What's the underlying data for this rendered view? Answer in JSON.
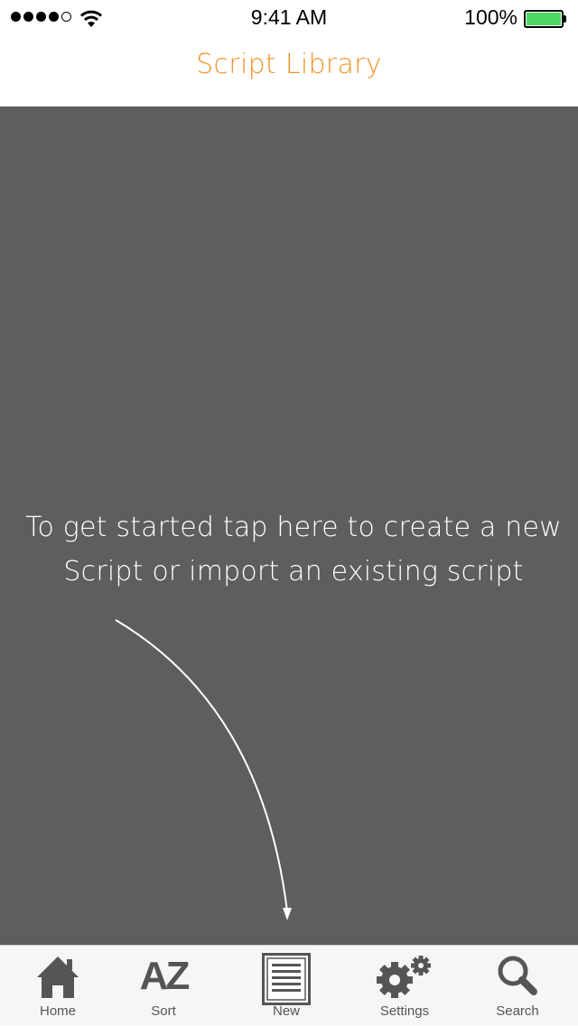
{
  "status_bar": {
    "time": "9:41 AM",
    "battery": "100%"
  },
  "nav": {
    "title": "Script Library"
  },
  "content": {
    "hint_line1": "To get started tap here to create a new",
    "hint_line2": "Script or import an existing script"
  },
  "tabs": [
    {
      "label": "Home",
      "icon": "home-icon"
    },
    {
      "label": "Sort",
      "icon": "az-sort-icon",
      "glyph": "AZ"
    },
    {
      "label": "New",
      "icon": "new-document-icon"
    },
    {
      "label": "Settings",
      "icon": "gears-icon"
    },
    {
      "label": "Search",
      "icon": "search-icon"
    }
  ],
  "colors": {
    "accent": "#f0932b",
    "content_bg": "#5e5e5e",
    "tab_icon": "#555555",
    "battery": "#4cd964"
  }
}
